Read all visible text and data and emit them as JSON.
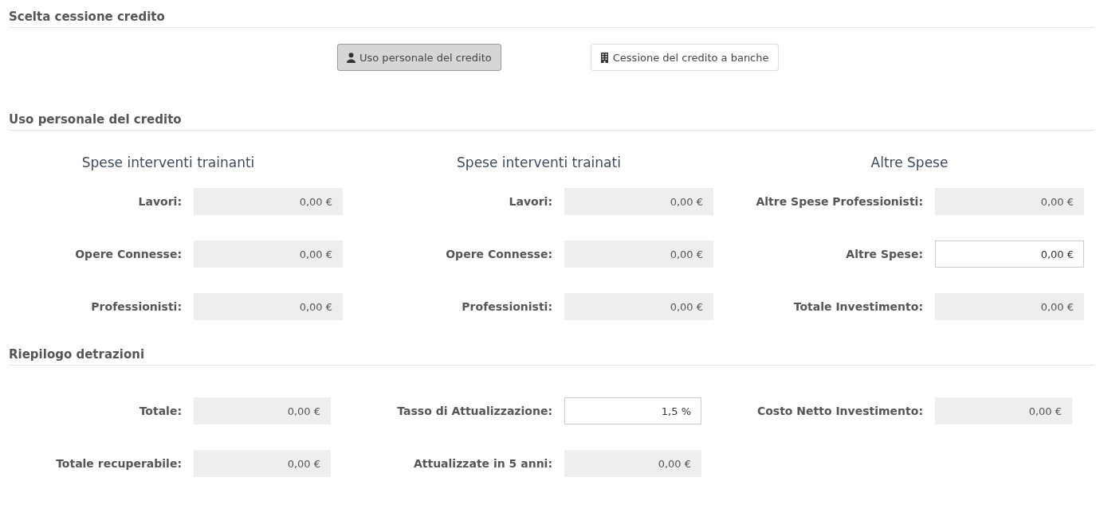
{
  "choice": {
    "title": "Scelta cessione credito",
    "buttons": [
      {
        "label": "Uso personale del credito",
        "selected": true
      },
      {
        "label": "Cessione del credito a banche",
        "selected": false
      }
    ]
  },
  "personal": {
    "title": "Uso personale del credito",
    "columns": [
      {
        "title": "Spese interventi trainanti",
        "fields": [
          {
            "label": "Lavori:",
            "value": "0,00 €",
            "disabled": true
          },
          {
            "label": "Opere Connesse:",
            "value": "0,00 €",
            "disabled": true
          },
          {
            "label": "Professionisti:",
            "value": "0,00 €",
            "disabled": true
          }
        ]
      },
      {
        "title": "Spese interventi trainati",
        "fields": [
          {
            "label": "Lavori:",
            "value": "0,00 €",
            "disabled": true
          },
          {
            "label": "Opere Connesse:",
            "value": "0,00 €",
            "disabled": true
          },
          {
            "label": "Professionisti:",
            "value": "0,00 €",
            "disabled": true
          }
        ]
      },
      {
        "title": "Altre Spese",
        "fields": [
          {
            "label": "Altre Spese Professionisti:",
            "value": "0,00 €",
            "disabled": true
          },
          {
            "label": "Altre Spese:",
            "value": "0,00 €",
            "disabled": false
          },
          {
            "label": "Totale Investimento:",
            "value": "0,00 €",
            "disabled": true
          }
        ]
      }
    ]
  },
  "summary": {
    "title": "Riepilogo detrazioni",
    "columns": [
      {
        "fields": [
          {
            "label": "Totale:",
            "value": "0,00 €",
            "disabled": true
          },
          {
            "label": "Totale recuperabile:",
            "value": "0,00 €",
            "disabled": true
          }
        ]
      },
      {
        "fields": [
          {
            "label": "Tasso di Attualizzazione:",
            "value": "1,5 %",
            "disabled": false
          },
          {
            "label": "Attualizzate in 5 anni:",
            "value": "0,00 €",
            "disabled": true
          }
        ]
      },
      {
        "fields": [
          {
            "label": "Costo Netto Investimento:",
            "value": "0,00 €",
            "disabled": true
          }
        ]
      }
    ]
  }
}
